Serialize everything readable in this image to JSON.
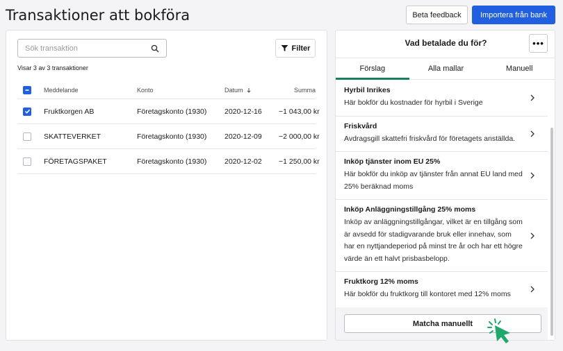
{
  "header": {
    "title": "Transaktioner att bokföra",
    "beta_feedback": "Beta feedback",
    "import_bank": "Importera från bank"
  },
  "left": {
    "search_placeholder": "Sök transaktion",
    "filter_label": "Filter",
    "count_text": "Visar 3 av 3 transaktioner",
    "columns": {
      "message": "Meddelande",
      "account": "Konto",
      "date": "Datum",
      "date_sort_icon": "arrow-down",
      "sum": "Summa"
    },
    "rows": [
      {
        "message": "Fruktkorgen AB",
        "account": "Företagskonto (1930)",
        "date": "2020-12-16",
        "sum": "−1 043,00 kr",
        "checked": true
      },
      {
        "message": "SKATTEVERKET",
        "account": "Företagskonto (1930)",
        "date": "2020-12-09",
        "sum": "−2 000,00 kr",
        "checked": false
      },
      {
        "message": "FÖRETAGSPAKET",
        "account": "Företagskonto (1930)",
        "date": "2020-12-02",
        "sum": "−1 250,00 kr",
        "checked": false
      }
    ]
  },
  "right": {
    "title": "Vad betalade du för?",
    "more_icon": "ellipsis",
    "tabs": [
      "Förslag",
      "Alla mallar",
      "Manuell"
    ],
    "active_tab": "Förslag",
    "items": [
      {
        "title": "Hyrbil Inrikes",
        "desc": "Här bokför du kostnader för hyrbil i Sverige"
      },
      {
        "title": "Friskvård",
        "desc": "Avdragsgill skattefri friskvård för företagets anställda."
      },
      {
        "title": "Inköp tjänster inom EU 25%",
        "desc": "Här bokför du inköp av tjänster från annat EU land med 25% beräknad moms"
      },
      {
        "title": "Inköp Anläggningstillgång 25% moms",
        "desc": "Inköp av anläggningstillgångar, vilket är en tillgång som är avsedd för stadigvarande bruk eller innehav, som har en nyttjandeperiod på minst tre år och har ett högre värde än ett halvt prisbasbelopp."
      },
      {
        "title": "Fruktkorg 12% moms",
        "desc": "Här bokför du fruktkorg till kontoret med 12% moms"
      }
    ],
    "match_button": "Matcha manuellt"
  },
  "colors": {
    "primary": "#1f5fe0",
    "tab_active": "#167f5b",
    "cursor": "#1fa86a"
  }
}
